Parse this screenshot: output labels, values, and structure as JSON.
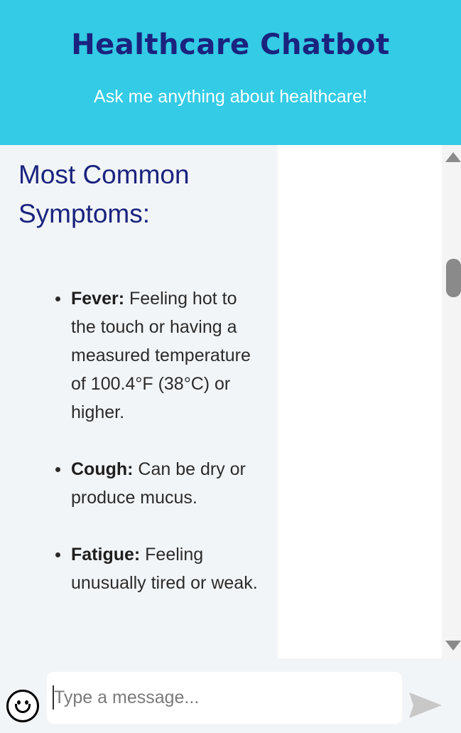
{
  "header": {
    "title": "Healthcare Chatbot",
    "subtitle": "Ask me anything about healthcare!"
  },
  "chat": {
    "message": {
      "heading": "Most Common Symptoms:",
      "symptoms": [
        {
          "term": "Fever:",
          "description": " Feeling hot to the touch or having a measured temperature of 100.4°F (38°C) or higher."
        },
        {
          "term": "Cough:",
          "description": " Can be dry or produce mucus."
        },
        {
          "term": "Fatigue:",
          "description": " Feeling unusually tired or weak."
        }
      ]
    }
  },
  "composer": {
    "placeholder": "Type a message...",
    "emoji_icon": "smiley-face-icon",
    "send_icon": "send-arrow-icon"
  },
  "colors": {
    "header_bg": "#33cbe5",
    "title": "#1a237e",
    "subtitle": "#ffffff",
    "bot_bubble_bg": "#f2f5f8",
    "send_icon": "#c8c8c8"
  }
}
